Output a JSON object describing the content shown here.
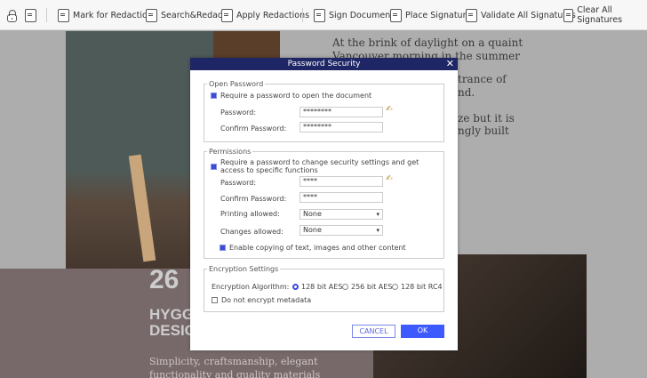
{
  "toolbar": {
    "items": [
      {
        "label": "",
        "icon": "lock-icon"
      },
      {
        "label": "",
        "icon": "document-lock-icon"
      },
      {
        "label": "Mark for Redaction",
        "icon": "mark-redaction-icon"
      },
      {
        "label": "Search&Redact",
        "icon": "search-redact-icon"
      },
      {
        "label": "Apply Redactions",
        "icon": "apply-redactions-icon"
      },
      {
        "label": "Sign Document",
        "icon": "sign-document-icon"
      },
      {
        "label": "Place Signature",
        "icon": "place-signature-icon"
      },
      {
        "label": "Validate All Signatures",
        "icon": "validate-signatures-icon"
      },
      {
        "label": "Clear All Signatures",
        "icon": "clear-signatures-icon"
      }
    ]
  },
  "document": {
    "lines": [
      "At the brink of daylight on a quaint",
      "Vancouver morning in the summer",
      "trance of",
      "nd.",
      "ze but it is",
      "ngly built"
    ],
    "number": "26",
    "heading1": "HYGG",
    "heading2": "DESIG",
    "sub1": "Simplicity, craftsmanship, elegant",
    "sub2": "functionality and quality materials"
  },
  "dialog": {
    "title": "Password Security",
    "open_password": {
      "legend": "Open Password",
      "require_label": "Require a password to open the document",
      "require_checked": true,
      "password_label": "Password:",
      "password_value": "********",
      "confirm_label": "Confirm Password:",
      "confirm_value": "********"
    },
    "permissions": {
      "legend": "Permissions",
      "require_label_1": "Require a password to change security settings and get",
      "require_label_2": "access to specific functions",
      "require_checked": true,
      "password_label": "Password:",
      "password_value": "****",
      "confirm_label": "Confirm Password:",
      "confirm_value": "****",
      "printing_label": "Printing allowed:",
      "printing_value": "None",
      "changes_label": "Changes allowed:",
      "changes_value": "None",
      "copy_label": "Enable copying of text, images and other content",
      "copy_checked": true
    },
    "encryption": {
      "legend": "Encryption Settings",
      "algorithm_label": "Encryption Algorithm:",
      "options": [
        "128 bit AES",
        "256 bit AES",
        "128 bit RC4"
      ],
      "selected": "128 bit AES",
      "metadata_label": "Do not encrypt metadata",
      "metadata_checked": false
    },
    "cancel": "CANCEL",
    "ok": "OK"
  },
  "colors": {
    "title_bar": "#1f2665",
    "accent": "#3d5afe"
  }
}
